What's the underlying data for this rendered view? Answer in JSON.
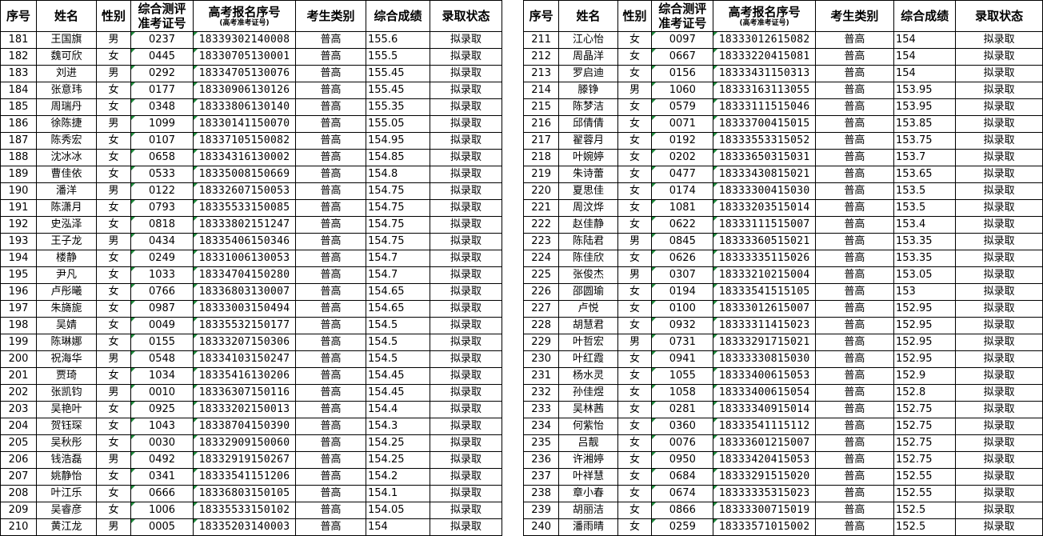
{
  "headers": {
    "seq": "序号",
    "name": "姓名",
    "gender": "性别",
    "cert_line1": "综合测评",
    "cert_line2": "准考证号",
    "reg_main": "高考报名序号",
    "reg_sub": "(高考准考证号)",
    "category": "考生类别",
    "score": "综合成绩",
    "status": "录取状态"
  },
  "left_rows": [
    [
      "181",
      "王国旗",
      "男",
      "0237",
      "18339302140008",
      "普高",
      "155.6",
      "拟录取"
    ],
    [
      "182",
      "魏可欣",
      "女",
      "0445",
      "18330705130001",
      "普高",
      "155.5",
      "拟录取"
    ],
    [
      "183",
      "刘进",
      "男",
      "0292",
      "18334705130076",
      "普高",
      "155.45",
      "拟录取"
    ],
    [
      "184",
      "张意玮",
      "女",
      "0177",
      "18330906130126",
      "普高",
      "155.45",
      "拟录取"
    ],
    [
      "185",
      "周瑞丹",
      "女",
      "0348",
      "18333806130140",
      "普高",
      "155.35",
      "拟录取"
    ],
    [
      "186",
      "徐陈捷",
      "男",
      "1099",
      "18330141150070",
      "普高",
      "155.05",
      "拟录取"
    ],
    [
      "187",
      "陈秀宏",
      "女",
      "0107",
      "18337105150082",
      "普高",
      "154.95",
      "拟录取"
    ],
    [
      "188",
      "沈冰冰",
      "女",
      "0658",
      "18334316130002",
      "普高",
      "154.85",
      "拟录取"
    ],
    [
      "189",
      "曹佳依",
      "女",
      "0533",
      "18335008150669",
      "普高",
      "154.8",
      "拟录取"
    ],
    [
      "190",
      "潘洋",
      "男",
      "0122",
      "18332607150053",
      "普高",
      "154.75",
      "拟录取"
    ],
    [
      "191",
      "陈潇月",
      "女",
      "0793",
      "18335533150085",
      "普高",
      "154.75",
      "拟录取"
    ],
    [
      "192",
      "史泓泽",
      "女",
      "0818",
      "18333802151247",
      "普高",
      "154.75",
      "拟录取"
    ],
    [
      "193",
      "王子龙",
      "男",
      "0434",
      "18335406150346",
      "普高",
      "154.75",
      "拟录取"
    ],
    [
      "194",
      "楼静",
      "女",
      "0249",
      "18331006130053",
      "普高",
      "154.7",
      "拟录取"
    ],
    [
      "195",
      "尹凡",
      "女",
      "1033",
      "18334704150280",
      "普高",
      "154.7",
      "拟录取"
    ],
    [
      "196",
      "卢彤曦",
      "女",
      "0766",
      "18336803130007",
      "普高",
      "154.65",
      "拟录取"
    ],
    [
      "197",
      "朱旖旎",
      "女",
      "0987",
      "18333003150494",
      "普高",
      "154.65",
      "拟录取"
    ],
    [
      "198",
      "吴婧",
      "女",
      "0049",
      "18335532150177",
      "普高",
      "154.5",
      "拟录取"
    ],
    [
      "199",
      "陈琳娜",
      "女",
      "0155",
      "18333207150306",
      "普高",
      "154.5",
      "拟录取"
    ],
    [
      "200",
      "祝海华",
      "男",
      "0548",
      "18334103150247",
      "普高",
      "154.5",
      "拟录取"
    ],
    [
      "201",
      "贾琦",
      "女",
      "1034",
      "18335416130206",
      "普高",
      "154.45",
      "拟录取"
    ],
    [
      "202",
      "张凯钧",
      "男",
      "0010",
      "18336307150116",
      "普高",
      "154.45",
      "拟录取"
    ],
    [
      "203",
      "吴艳叶",
      "女",
      "0925",
      "18333202150013",
      "普高",
      "154.4",
      "拟录取"
    ],
    [
      "204",
      "贺钰琛",
      "女",
      "1043",
      "18338704150390",
      "普高",
      "154.3",
      "拟录取"
    ],
    [
      "205",
      "吴秋彤",
      "女",
      "0030",
      "18332909150060",
      "普高",
      "154.25",
      "拟录取"
    ],
    [
      "206",
      "钱浩磊",
      "男",
      "0492",
      "18332919150267",
      "普高",
      "154.25",
      "拟录取"
    ],
    [
      "207",
      "姚静怡",
      "女",
      "0341",
      "18333541151206",
      "普高",
      "154.2",
      "拟录取"
    ],
    [
      "208",
      "叶江乐",
      "女",
      "0666",
      "18336803150105",
      "普高",
      "154.1",
      "拟录取"
    ],
    [
      "209",
      "吴睿彦",
      "女",
      "1006",
      "18335533150102",
      "普高",
      "154.05",
      "拟录取"
    ],
    [
      "210",
      "黄江龙",
      "男",
      "0005",
      "18335203140003",
      "普高",
      "154",
      "拟录取"
    ]
  ],
  "right_rows": [
    [
      "211",
      "江心怡",
      "女",
      "0097",
      "18333012615082",
      "普高",
      "154",
      "拟录取"
    ],
    [
      "212",
      "周晶洋",
      "女",
      "0667",
      "18333220415081",
      "普高",
      "154",
      "拟录取"
    ],
    [
      "213",
      "罗启迪",
      "女",
      "0156",
      "18333431150313",
      "普高",
      "154",
      "拟录取"
    ],
    [
      "214",
      "滕铮",
      "男",
      "1060",
      "18333163113055",
      "普高",
      "153.95",
      "拟录取"
    ],
    [
      "215",
      "陈梦洁",
      "女",
      "0579",
      "18333111515046",
      "普高",
      "153.95",
      "拟录取"
    ],
    [
      "216",
      "邱倩倩",
      "女",
      "0071",
      "18333700415015",
      "普高",
      "153.85",
      "拟录取"
    ],
    [
      "217",
      "翟蓉月",
      "女",
      "0192",
      "18333553315052",
      "普高",
      "153.75",
      "拟录取"
    ],
    [
      "218",
      "叶婉婷",
      "女",
      "0202",
      "18333650315031",
      "普高",
      "153.7",
      "拟录取"
    ],
    [
      "219",
      "朱诗蕾",
      "女",
      "0477",
      "18333430815021",
      "普高",
      "153.65",
      "拟录取"
    ],
    [
      "220",
      "夏思佳",
      "女",
      "0174",
      "18333300415030",
      "普高",
      "153.5",
      "拟录取"
    ],
    [
      "221",
      "周汶烨",
      "女",
      "1081",
      "18333203515014",
      "普高",
      "153.5",
      "拟录取"
    ],
    [
      "222",
      "赵佳静",
      "女",
      "0622",
      "18333111515007",
      "普高",
      "153.4",
      "拟录取"
    ],
    [
      "223",
      "陈陆君",
      "男",
      "0845",
      "18333360515021",
      "普高",
      "153.35",
      "拟录取"
    ],
    [
      "224",
      "陈佳欣",
      "女",
      "0626",
      "18333335115026",
      "普高",
      "153.35",
      "拟录取"
    ],
    [
      "225",
      "张俊杰",
      "男",
      "0307",
      "18333210215004",
      "普高",
      "153.05",
      "拟录取"
    ],
    [
      "226",
      "邵圆瑜",
      "女",
      "0194",
      "18333541515105",
      "普高",
      "153",
      "拟录取"
    ],
    [
      "227",
      "卢悦",
      "女",
      "0100",
      "18333012615007",
      "普高",
      "152.95",
      "拟录取"
    ],
    [
      "228",
      "胡慧君",
      "女",
      "0932",
      "18333311415023",
      "普高",
      "152.95",
      "拟录取"
    ],
    [
      "229",
      "叶哲宏",
      "男",
      "0731",
      "18333291715021",
      "普高",
      "152.95",
      "拟录取"
    ],
    [
      "230",
      "叶红霞",
      "女",
      "0941",
      "18333330815030",
      "普高",
      "152.95",
      "拟录取"
    ],
    [
      "231",
      "杨水灵",
      "女",
      "1055",
      "18333400615053",
      "普高",
      "152.9",
      "拟录取"
    ],
    [
      "232",
      "孙佳煜",
      "女",
      "1058",
      "18333400615054",
      "普高",
      "152.8",
      "拟录取"
    ],
    [
      "233",
      "吴林茜",
      "女",
      "0281",
      "18333340915014",
      "普高",
      "152.75",
      "拟录取"
    ],
    [
      "234",
      "何紫怡",
      "女",
      "0360",
      "18333541115112",
      "普高",
      "152.75",
      "拟录取"
    ],
    [
      "235",
      "吕靓",
      "女",
      "0076",
      "18333601215007",
      "普高",
      "152.75",
      "拟录取"
    ],
    [
      "236",
      "许湘婷",
      "女",
      "0950",
      "18333420415053",
      "普高",
      "152.75",
      "拟录取"
    ],
    [
      "237",
      "叶祥慧",
      "女",
      "0684",
      "18333291515020",
      "普高",
      "152.55",
      "拟录取"
    ],
    [
      "238",
      "章小春",
      "女",
      "0674",
      "18333335315023",
      "普高",
      "152.55",
      "拟录取"
    ],
    [
      "239",
      "胡丽洁",
      "女",
      "0866",
      "18333300715019",
      "普高",
      "152.5",
      "拟录取"
    ],
    [
      "240",
      "潘雨晴",
      "女",
      "0259",
      "18333571015002",
      "普高",
      "152.5",
      "拟录取"
    ]
  ]
}
